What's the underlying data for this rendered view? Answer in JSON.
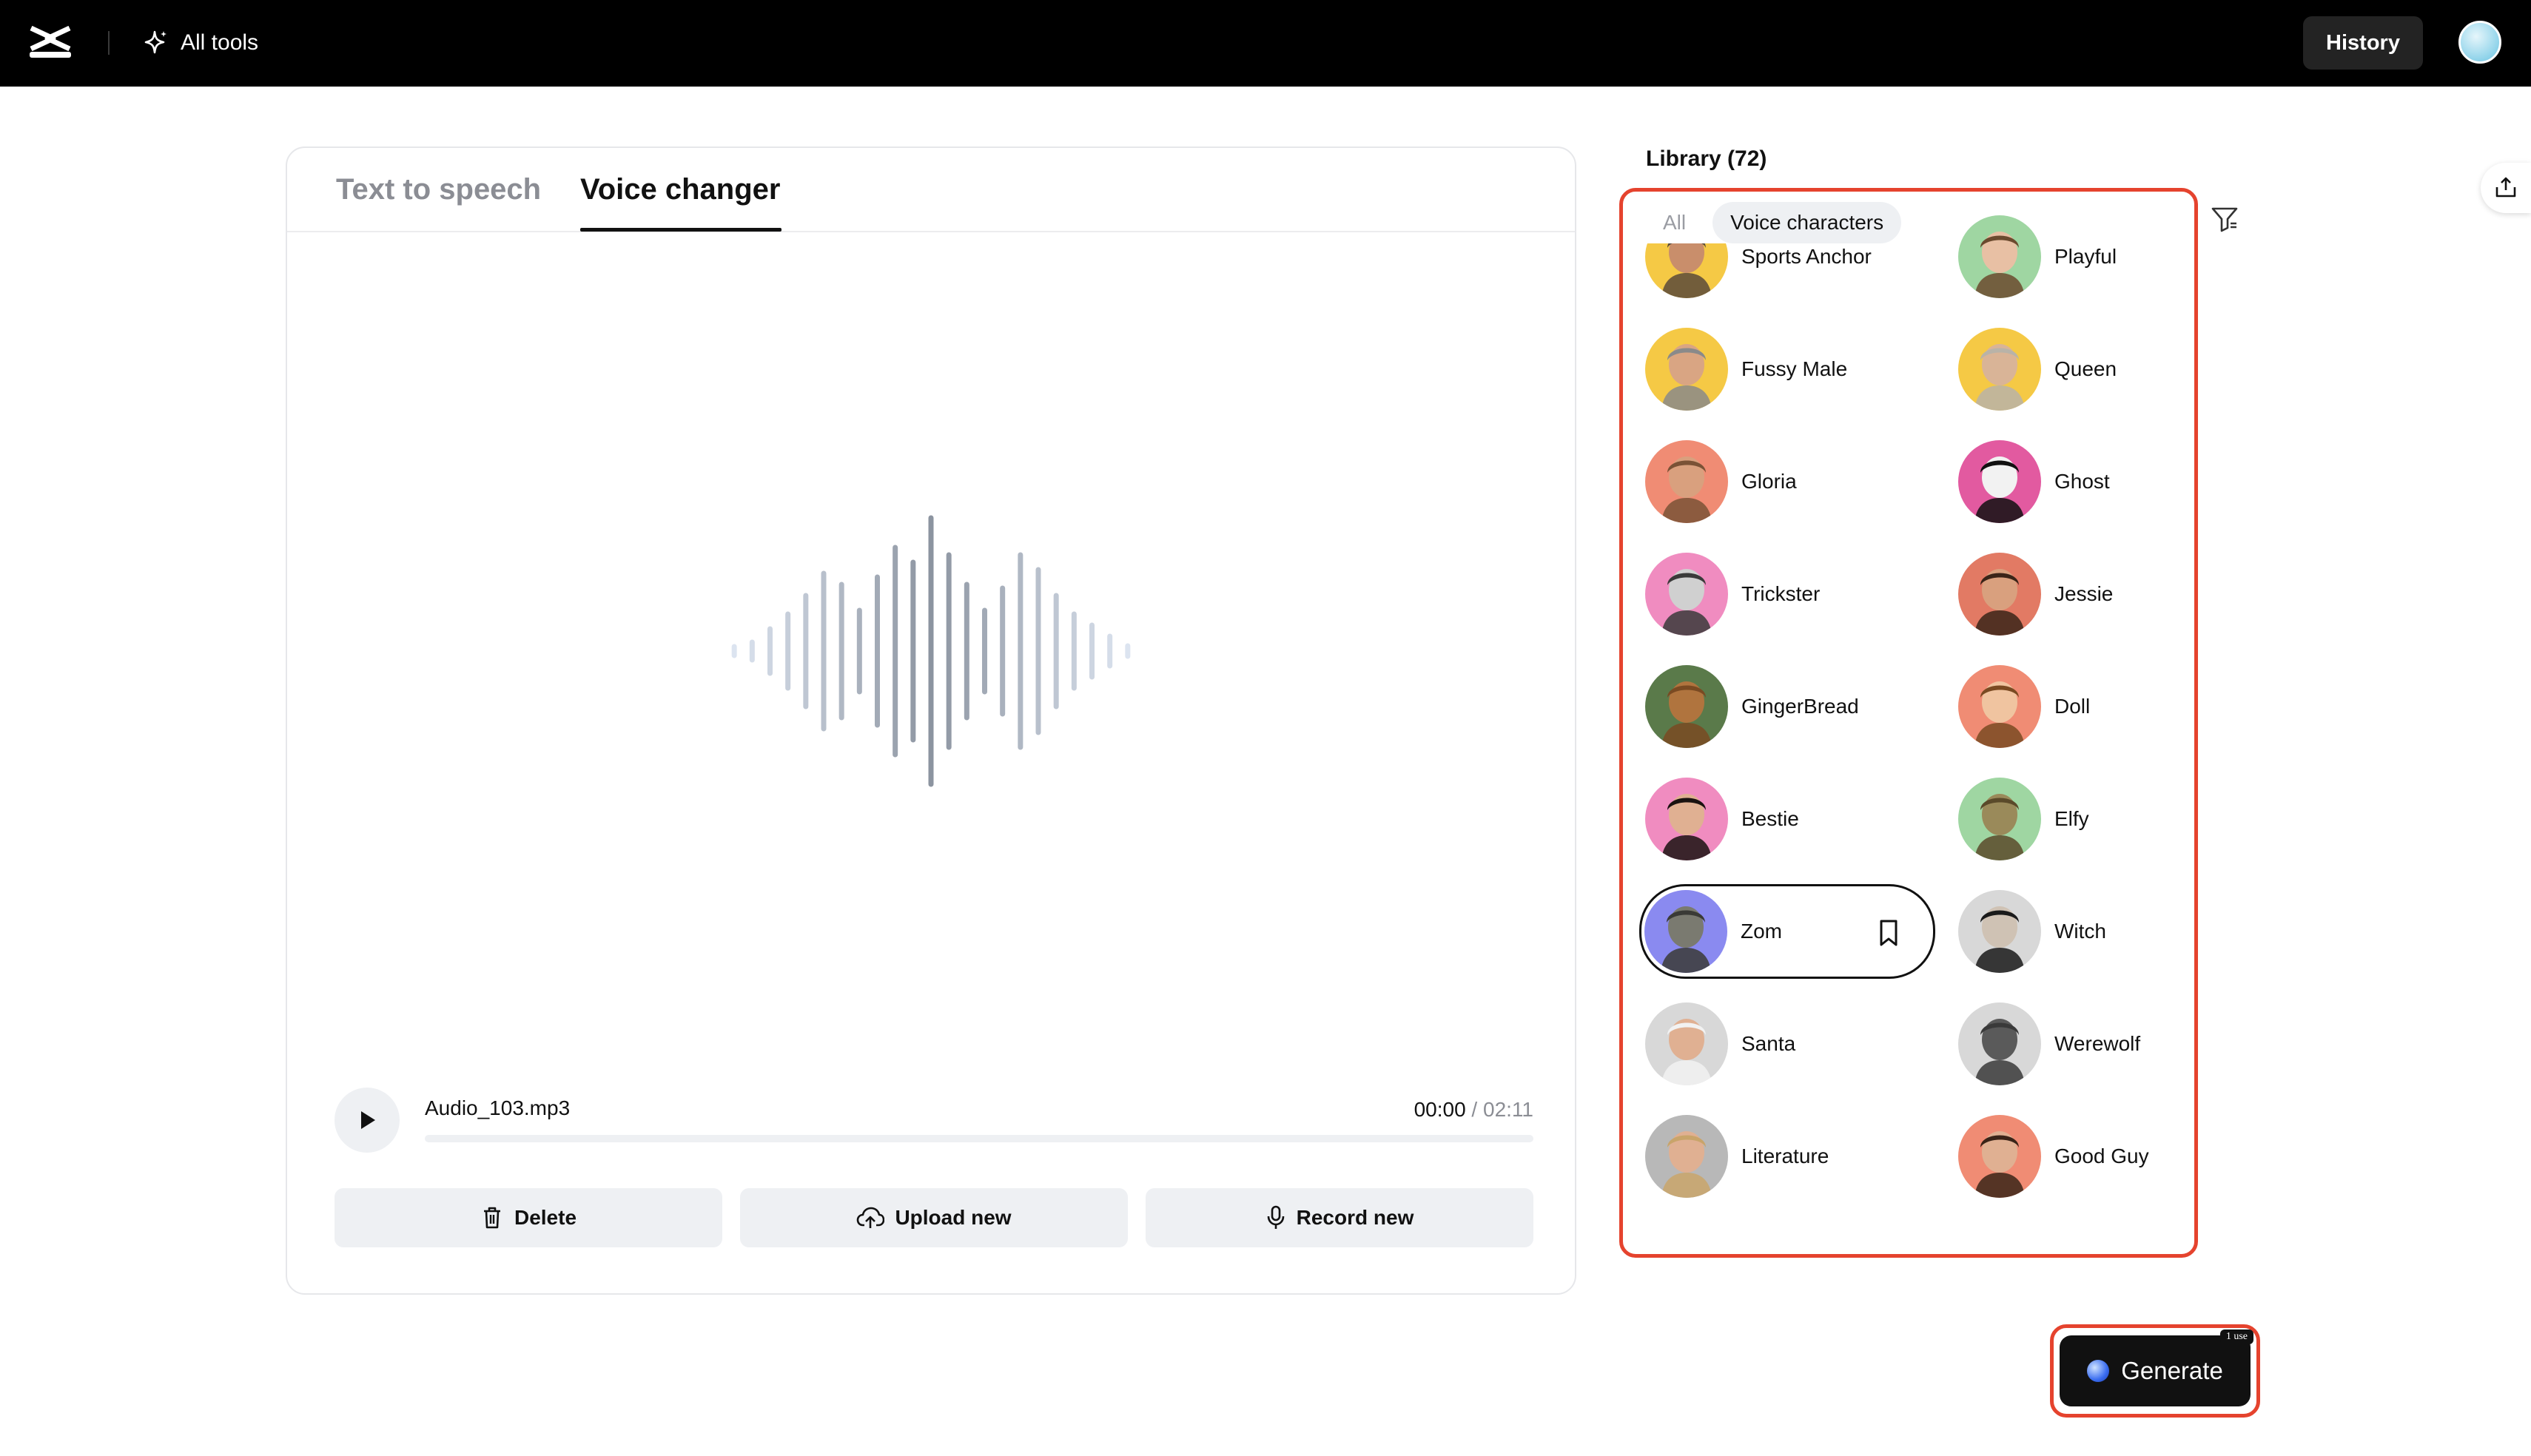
{
  "topbar": {
    "all_tools_label": "All tools",
    "history_label": "History"
  },
  "tabs": [
    {
      "label": "Text to speech",
      "active": false
    },
    {
      "label": "Voice changer",
      "active": true
    }
  ],
  "player": {
    "filename": "Audio_103.mp3",
    "current_time": "00:00",
    "separator": " / ",
    "total_time": "02:11",
    "progress_fraction": 0
  },
  "actions": {
    "delete_label": "Delete",
    "upload_label": "Upload new",
    "record_label": "Record new"
  },
  "library": {
    "title": "Library (72)",
    "filters": [
      {
        "label": "All",
        "active": false
      },
      {
        "label": "Voice characters",
        "active": true
      }
    ],
    "voices": [
      {
        "name": "Sports Anchor",
        "bg": "#f5c945",
        "skin": "#c98e6b",
        "hair": "#5a4a3a"
      },
      {
        "name": "Playful",
        "bg": "#9fd6a2",
        "skin": "#e8c0a4",
        "hair": "#6b4a2e"
      },
      {
        "name": "Fussy Male",
        "bg": "#f5c945",
        "skin": "#d9a583",
        "hair": "#8a8a8a"
      },
      {
        "name": "Queen",
        "bg": "#f5c945",
        "skin": "#d9b497",
        "hair": "#b9b3a8"
      },
      {
        "name": "Gloria",
        "bg": "#f08c74",
        "skin": "#d9a07e",
        "hair": "#7a5236"
      },
      {
        "name": "Ghost",
        "bg": "#e25aa0",
        "skin": "#f2f2f2",
        "hair": "#111111"
      },
      {
        "name": "Trickster",
        "bg": "#f08cc0",
        "skin": "#d0d0d0",
        "hair": "#3a3a3a"
      },
      {
        "name": "Jessie",
        "bg": "#e27a64",
        "skin": "#d9a07e",
        "hair": "#3a2418"
      },
      {
        "name": "GingerBread",
        "bg": "#5a7a4a",
        "skin": "#b0743e",
        "hair": "#7a4a22"
      },
      {
        "name": "Doll",
        "bg": "#f08c74",
        "skin": "#f0c4a0",
        "hair": "#7a4a22"
      },
      {
        "name": "Bestie",
        "bg": "#f08cc0",
        "skin": "#e0b092",
        "hair": "#1a1210"
      },
      {
        "name": "Elfy",
        "bg": "#9fd6a2",
        "skin": "#9a8a5a",
        "hair": "#5a4a2a"
      },
      {
        "name": "Zombie",
        "display": "Zom",
        "bg": "#8a8af0",
        "skin": "#7a7a70",
        "hair": "#3a3a36",
        "selected": true
      },
      {
        "name": "Witch",
        "bg": "#d8d8d8",
        "skin": "#cfc2b4",
        "hair": "#1a1a1a"
      },
      {
        "name": "Santa",
        "bg": "#d8d8d8",
        "skin": "#e0b092",
        "hair": "#f2f2f2"
      },
      {
        "name": "Werewolf",
        "bg": "#d8d8d8",
        "skin": "#5a5a5a",
        "hair": "#3a3a3a"
      },
      {
        "name": "Literature",
        "bg": "#b8b8b8",
        "skin": "#e0b092",
        "hair": "#c9a46a"
      },
      {
        "name": "Good Guy",
        "bg": "#f08c74",
        "skin": "#e0b092",
        "hair": "#3a2418"
      }
    ]
  },
  "generate": {
    "label": "Generate",
    "badge": "1 use"
  },
  "colors": {
    "accent_outline": "#e5432e",
    "topbar_bg": "#000000",
    "button_bg": "#eef0f3"
  }
}
